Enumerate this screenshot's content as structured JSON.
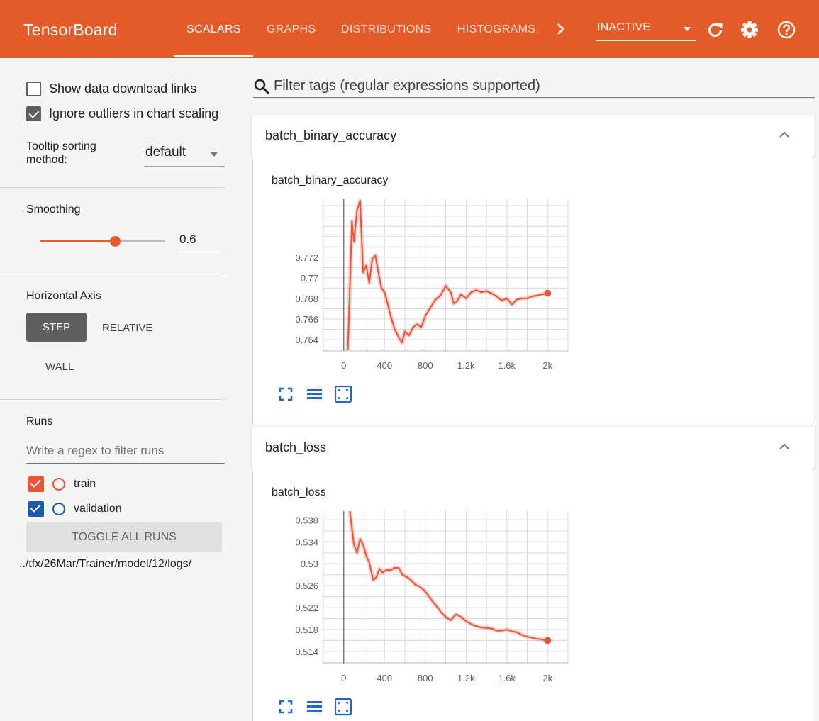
{
  "header": {
    "app_title": "TensorBoard",
    "tabs": [
      {
        "label": "SCALARS"
      },
      {
        "label": "GRAPHS"
      },
      {
        "label": "DISTRIBUTIONS"
      },
      {
        "label": "HISTOGRAMS"
      }
    ],
    "more_icon": "chevron-right-icon",
    "status_select": "INACTIVE",
    "icons": [
      "refresh-icon",
      "settings-icon",
      "help-icon"
    ],
    "accent_color": "#e45c2a"
  },
  "sidebar": {
    "show_download_links": {
      "label": "Show data download links",
      "checked": false
    },
    "ignore_outliers": {
      "label": "Ignore outliers in chart scaling",
      "checked": true
    },
    "tooltip_sorting": {
      "label": "Tooltip sorting method:",
      "value": "default"
    },
    "smoothing": {
      "title": "Smoothing",
      "value": "0.6",
      "fraction": 0.6
    },
    "horizontal_axis": {
      "title": "Horizontal Axis",
      "step": "STEP",
      "relative": "RELATIVE",
      "wall": "WALL"
    },
    "runs": {
      "title": "Runs",
      "filter_placeholder": "Write a regex to filter runs",
      "items": [
        {
          "name": "train",
          "color": "#e8553a",
          "checked": true
        },
        {
          "name": "validation",
          "color": "#1f5aa8",
          "checked": true
        }
      ],
      "toggle_all": "TOGGLE ALL RUNS",
      "logdir": "../tfx/26Mar/Trainer/model/12/logs/"
    }
  },
  "main": {
    "filter_placeholder": "Filter tags (regular expressions supported)",
    "cards": [
      {
        "name": "batch_binary_accuracy"
      },
      {
        "name": "batch_loss"
      }
    ],
    "chart_toolbar_icons": [
      "fullscreen-icon",
      "log-scale-icon",
      "fit-domain-icon"
    ]
  },
  "chart_data": [
    {
      "type": "line",
      "title": "batch_binary_accuracy",
      "xlabel": "",
      "ylabel": "",
      "x_ticks": [
        0,
        400,
        800,
        1200,
        1600,
        2000
      ],
      "x_tick_labels": [
        "0",
        "400",
        "800",
        "1.2k",
        "1.6k",
        "2k"
      ],
      "y_ticks": [
        0.764,
        0.766,
        0.768,
        0.77,
        0.772
      ],
      "y_tick_labels": [
        "0.764",
        "0.766",
        "0.768",
        "0.77",
        "0.772"
      ],
      "xlim": [
        -200,
        2200
      ],
      "ylim": [
        0.7629,
        0.7777
      ],
      "grid": true,
      "series": [
        {
          "name": "train",
          "color": "#e8553a",
          "x": [
            40,
            60,
            80,
            100,
            130,
            160,
            190,
            220,
            250,
            280,
            310,
            340,
            370,
            400,
            430,
            460,
            500,
            540,
            570,
            600,
            640,
            680,
            720,
            760,
            800,
            850,
            900,
            950,
            1000,
            1050,
            1080,
            1110,
            1150,
            1200,
            1250,
            1300,
            1350,
            1400,
            1450,
            1500,
            1550,
            1600,
            1650,
            1700,
            1750,
            1800,
            1850,
            1900,
            1950,
            2000
          ],
          "y": [
            0.763,
            0.769,
            0.7755,
            0.7735,
            0.7765,
            0.7775,
            0.7705,
            0.7712,
            0.7695,
            0.7718,
            0.7722,
            0.7705,
            0.769,
            0.7686,
            0.7675,
            0.7663,
            0.765,
            0.7642,
            0.7637,
            0.7648,
            0.7644,
            0.7652,
            0.7655,
            0.7652,
            0.7663,
            0.7671,
            0.7679,
            0.7683,
            0.7692,
            0.7686,
            0.7675,
            0.7677,
            0.7684,
            0.768,
            0.7686,
            0.7688,
            0.7686,
            0.7687,
            0.7685,
            0.7682,
            0.7678,
            0.768,
            0.7674,
            0.7679,
            0.768,
            0.768,
            0.7682,
            0.7683,
            0.7684,
            0.7685
          ]
        }
      ]
    },
    {
      "type": "line",
      "title": "batch_loss",
      "xlabel": "",
      "ylabel": "",
      "x_ticks": [
        0,
        400,
        800,
        1200,
        1600,
        2000
      ],
      "x_tick_labels": [
        "0",
        "400",
        "800",
        "1.2k",
        "1.6k",
        "2k"
      ],
      "y_ticks": [
        0.514,
        0.518,
        0.522,
        0.526,
        0.53,
        0.534,
        0.538
      ],
      "y_tick_labels": [
        "0.514",
        "0.518",
        "0.522",
        "0.526",
        "0.53",
        "0.534",
        "0.538"
      ],
      "xlim": [
        -200,
        2200
      ],
      "ylim": [
        0.5118,
        0.5396
      ],
      "grid": true,
      "series": [
        {
          "name": "train",
          "color": "#e8553a",
          "x": [
            60,
            80,
            100,
            130,
            160,
            190,
            220,
            250,
            290,
            320,
            350,
            380,
            420,
            460,
            500,
            540,
            580,
            620,
            660,
            700,
            740,
            780,
            820,
            860,
            900,
            950,
            1000,
            1050,
            1100,
            1150,
            1200,
            1250,
            1300,
            1350,
            1400,
            1450,
            1500,
            1550,
            1600,
            1650,
            1700,
            1750,
            1800,
            1850,
            1900,
            1950,
            2000
          ],
          "y": [
            0.5396,
            0.5365,
            0.5335,
            0.532,
            0.5345,
            0.5335,
            0.5315,
            0.5302,
            0.527,
            0.5276,
            0.5291,
            0.5284,
            0.5289,
            0.5288,
            0.5293,
            0.5292,
            0.5279,
            0.5276,
            0.527,
            0.5262,
            0.5259,
            0.5253,
            0.5245,
            0.5234,
            0.5225,
            0.5213,
            0.5203,
            0.5197,
            0.5208,
            0.5203,
            0.5195,
            0.519,
            0.5186,
            0.5184,
            0.5183,
            0.5182,
            0.5178,
            0.5178,
            0.518,
            0.5177,
            0.5175,
            0.517,
            0.5167,
            0.5165,
            0.5163,
            0.5162,
            0.516
          ]
        }
      ]
    }
  ]
}
